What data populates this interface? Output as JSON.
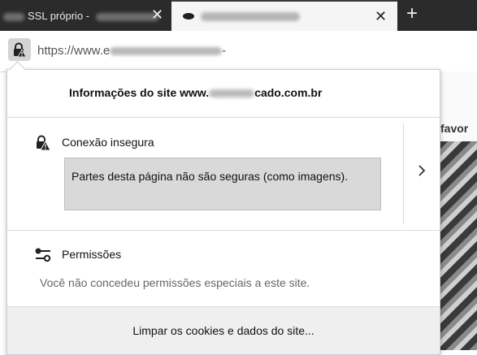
{
  "tabs": [
    {
      "title": "SSL próprio - ",
      "active": false,
      "close_label": "✕"
    },
    {
      "title": "",
      "active": true,
      "close_label": "✕"
    }
  ],
  "new_tab_label": "+",
  "urlbar": {
    "protocol_text": "https://www.e",
    "tail_text": "-"
  },
  "background_page": {
    "heading_fragment": "favor"
  },
  "site_info": {
    "title": "Informações do site www.",
    "title_suffix": "cado.com.br",
    "connection": {
      "label": "Conexão insegura",
      "description": "Partes desta página não são seguras (como imagens).",
      "more_icon": "chevron-right-icon"
    },
    "permissions": {
      "label": "Permissões",
      "description": "Você não concedeu permissões especiais a este site."
    },
    "clear_button_label": "Limpar os cookies e dados do site..."
  },
  "icons": {
    "insecure": "lock-warning-icon",
    "permissions": "permissions-sliders-icon"
  }
}
